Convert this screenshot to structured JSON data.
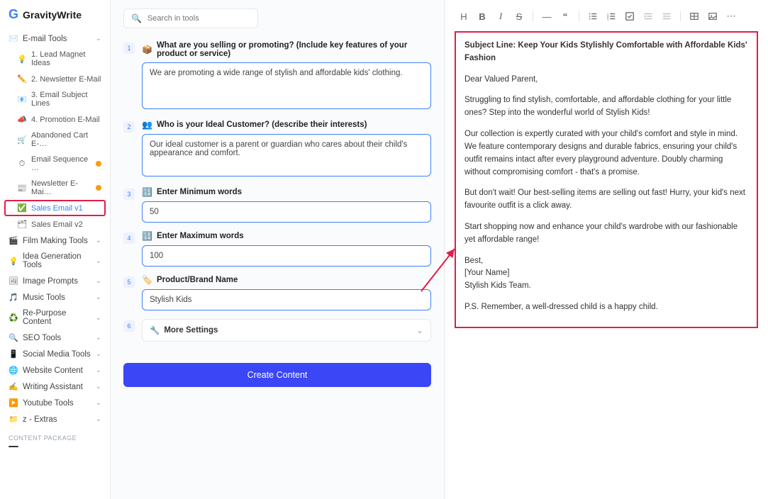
{
  "logo": {
    "text": "GravityWrite"
  },
  "search": {
    "placeholder": "Search in tools"
  },
  "sidebar": {
    "emailTools": {
      "label": "E-mail Tools"
    },
    "emailChildren": [
      {
        "icon": "💡",
        "label": "1. Lead Magnet Ideas"
      },
      {
        "icon": "✏️",
        "label": "2. Newsletter E-Mail"
      },
      {
        "icon": "📧",
        "label": "3. Email Subject Lines"
      },
      {
        "icon": "📣",
        "label": "4. Promotion E-Mail"
      },
      {
        "icon": "🛒",
        "label": "Abandoned Cart E-…"
      },
      {
        "icon": "⏱",
        "label": "Email Sequence …",
        "badge": true
      },
      {
        "icon": "📰",
        "label": "Newsletter E-Mai…",
        "badge": true
      },
      {
        "icon": "✅",
        "label": "Sales Email v1",
        "active": true,
        "highlight": true
      },
      {
        "icon": "🗂",
        "label": "Sales Email v2"
      }
    ],
    "cats": [
      {
        "icon": "🎬",
        "label": "Film Making Tools"
      },
      {
        "icon": "💡",
        "label": "Idea Generation Tools"
      },
      {
        "icon": "🖼",
        "label": "Image Prompts"
      },
      {
        "icon": "🎵",
        "label": "Music Tools"
      },
      {
        "icon": "♻️",
        "label": "Re-Purpose Content"
      },
      {
        "icon": "🔍",
        "label": "SEO Tools"
      },
      {
        "icon": "📱",
        "label": "Social Media Tools"
      },
      {
        "icon": "🌐",
        "label": "Website Content"
      },
      {
        "icon": "✍️",
        "label": "Writing Assistant"
      },
      {
        "icon": "▶️",
        "label": "Youtube Tools"
      },
      {
        "icon": "📁",
        "label": "z - Extras"
      }
    ],
    "packageLabel": "CONTENT PACKAGE"
  },
  "form": {
    "q1": {
      "num": "1",
      "icon": "📦",
      "label": "What are you selling or promoting? (Include key features of your product or service)",
      "value": "We are promoting a wide range of stylish and affordable kids' clothing."
    },
    "q2": {
      "num": "2",
      "icon": "👥",
      "label": "Who is your Ideal Customer? (describe their interests)",
      "value": "Our ideal customer is a parent or guardian who cares about their child's appearance and comfort."
    },
    "q3": {
      "num": "3",
      "icon": "🔢",
      "label": "Enter Minimum words",
      "value": "50"
    },
    "q4": {
      "num": "4",
      "icon": "🔢",
      "label": "Enter Maximum words",
      "value": "100"
    },
    "q5": {
      "num": "5",
      "icon": "🏷️",
      "label": "Product/Brand Name",
      "value": "Stylish Kids"
    },
    "q6": {
      "num": "6",
      "icon": "🔧",
      "label": "More Settings"
    },
    "button": "Create Content"
  },
  "output": {
    "subject": "Subject Line: Keep Your Kids Stylishly Comfortable with Affordable Kids' Fashion",
    "p1": "Dear Valued Parent,",
    "p2": "Struggling to find stylish, comfortable, and affordable clothing for your little ones? Step into the wonderful world of Stylish Kids!",
    "p3": "Our collection is expertly curated with your child's comfort and style in mind. We feature contemporary designs and durable fabrics, ensuring your child's outfit remains intact after every playground adventure. Doubly charming without compromising comfort - that's a promise.",
    "p4": "But don't wait! Our best-selling items are selling out fast! Hurry, your kid's next favourite outfit is a click away.",
    "p5": "Start shopping now and enhance your child's wardrobe with our fashionable yet affordable range!",
    "p6a": "Best,",
    "p6b": "[Your Name]",
    "p6c": "Stylish Kids Team.",
    "p7": "P.S. Remember, a well-dressed child is a happy child."
  }
}
